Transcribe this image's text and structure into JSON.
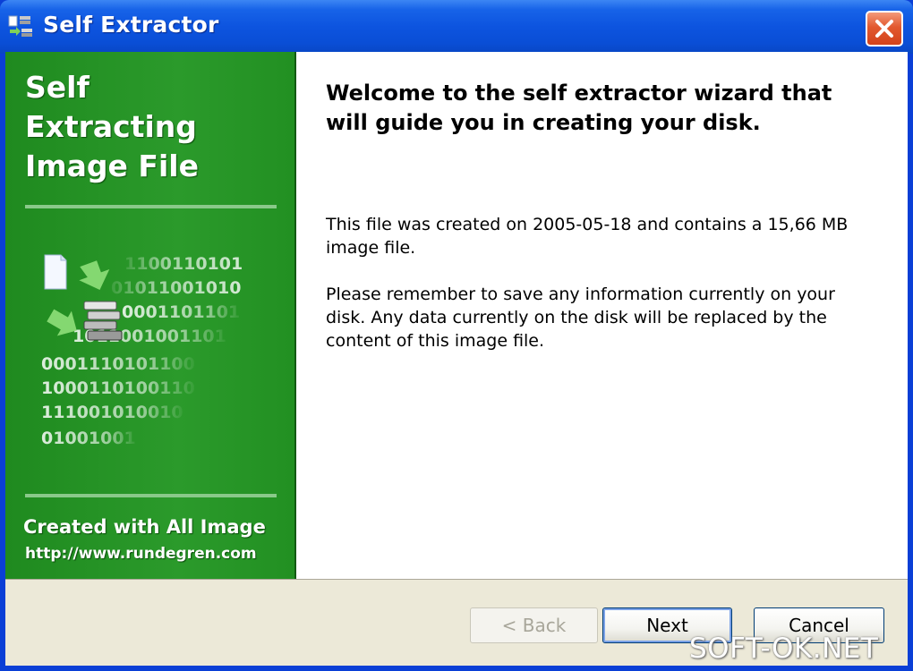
{
  "window": {
    "title": "Self Extractor"
  },
  "sidebar": {
    "title_lines": [
      "Self",
      "Extracting",
      "Image File"
    ],
    "binary_lines": [
      "1100110101",
      "01011001010",
      "0001101101",
      "1011001001101",
      "0001110101100",
      "1000110100110",
      "111001010010",
      "01001001"
    ],
    "footer_line1": "Created with All Image",
    "footer_line2": "http://www.rundegren.com",
    "colors": {
      "background": "#228b22",
      "rule": "#8ac98a"
    }
  },
  "main": {
    "heading": "Welcome to the self extractor wizard that will guide you in creating your disk.",
    "paragraph1": "This file was created on 2005-05-18 and contains a 15,66 MB image file.",
    "paragraph2": "Please remember to save any information currently on your disk. Any data currently on the disk will be replaced by the content of this image file."
  },
  "buttons": {
    "back_label": "< Back",
    "next_label": "Next",
    "cancel_label": "Cancel"
  },
  "watermark": {
    "text": "SOFT-OK.NET"
  },
  "icons": {
    "app": "app-icon",
    "close": "close-icon",
    "document": "document-icon",
    "disk_stack": "disk-stack-icon",
    "arrows": "green-arrow-icon"
  }
}
